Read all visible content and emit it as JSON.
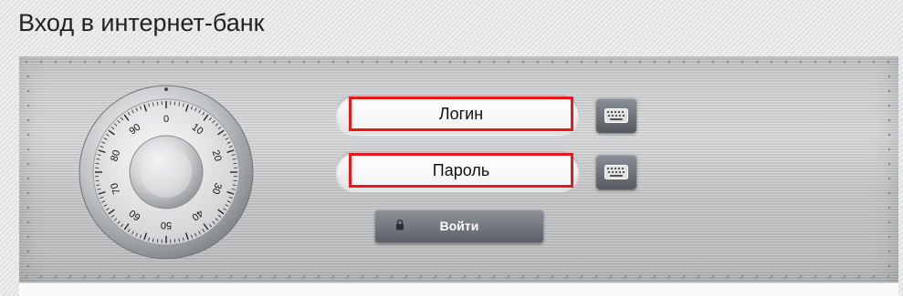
{
  "page": {
    "title": "Вход в интернет-банк"
  },
  "dial": {
    "numbers": [
      "0",
      "10",
      "20",
      "30",
      "40",
      "50",
      "60",
      "70",
      "80",
      "90"
    ]
  },
  "form": {
    "login_placeholder": "Логин",
    "password_placeholder": "Пароль",
    "submit_label": "Войти"
  },
  "icons": {
    "keyboard": "keyboard-icon",
    "lock": "lock-icon",
    "dial": "safe-dial-icon"
  },
  "colors": {
    "highlight_border": "#e8191d",
    "button": "#5c6168",
    "panel": "#cfd1d3"
  }
}
